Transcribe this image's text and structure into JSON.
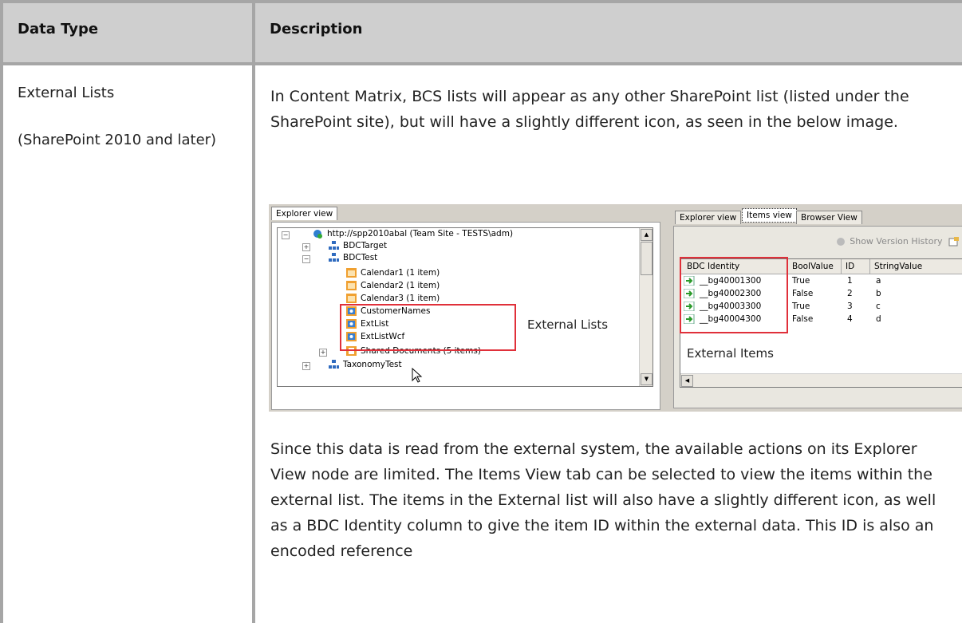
{
  "header": {
    "col_data_type": "Data Type",
    "col_description": "Description"
  },
  "row": {
    "data_type": "External Lists",
    "data_type_note": "(SharePoint 2010 and later)",
    "description_intro": "In Content Matrix, BCS lists will appear as any other SharePoint list (listed under the SharePoint site), but will have a slightly different icon, as seen in the below image.",
    "description_body": "Since this data is read from the external system, the available actions on its Explorer View node are limited. The Items View tab can be selected to view the items within the external list. The items in the External list will also have a slightly different icon, as well as a BDC Identity column to give the item ID within the external data. This ID is also an encoded reference"
  },
  "screenshot": {
    "left": {
      "tab": "Explorer view",
      "root": "http://spp2010abal (Team Site - TESTS\\adm)",
      "nodes": {
        "bdctarget": "BDCTarget",
        "bdctest": "BDCTest",
        "cal1": "Calendar1 (1 item)",
        "cal2": "Calendar2 (1 item)",
        "cal3": "Calendar3 (1 item)",
        "customer": "CustomerNames",
        "extlist": "ExtList",
        "extlistwcf": "ExtListWcf",
        "shared": "Shared Documents (5 items)",
        "taxonomy": "TaxonomyTest"
      },
      "callout": "External Lists"
    },
    "right": {
      "tabs": {
        "explorer": "Explorer view",
        "items": "Items view",
        "browser": "Browser View"
      },
      "toolbar_button": "Show Version History",
      "columns": {
        "bdc": "BDC Identity",
        "bool": "BoolValue",
        "id": "ID",
        "str": "StringValue"
      },
      "rows": [
        {
          "bdc": "__bg40001300",
          "bool": "True",
          "id": "1",
          "str": "a"
        },
        {
          "bdc": "__bg40002300",
          "bool": "False",
          "id": "2",
          "str": "b"
        },
        {
          "bdc": "__bg40003300",
          "bool": "True",
          "id": "3",
          "str": "c"
        },
        {
          "bdc": "__bg40004300",
          "bool": "False",
          "id": "4",
          "str": "d"
        }
      ],
      "callout": "External Items"
    }
  },
  "colors": {
    "header_bg": "#cfcfcf",
    "rule": "#a6a6a6",
    "callout_border": "#e0303a"
  }
}
